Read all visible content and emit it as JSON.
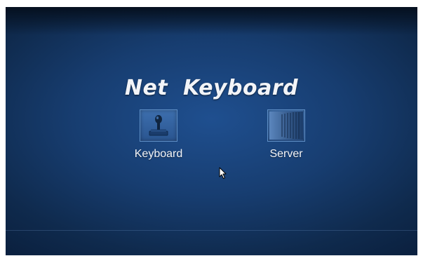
{
  "screen": {
    "title": "Net  Keyboard"
  },
  "apps": [
    {
      "label": "Keyboard",
      "icon": "joystick-icon"
    },
    {
      "label": "Server",
      "icon": "server-rack-icon"
    }
  ]
}
